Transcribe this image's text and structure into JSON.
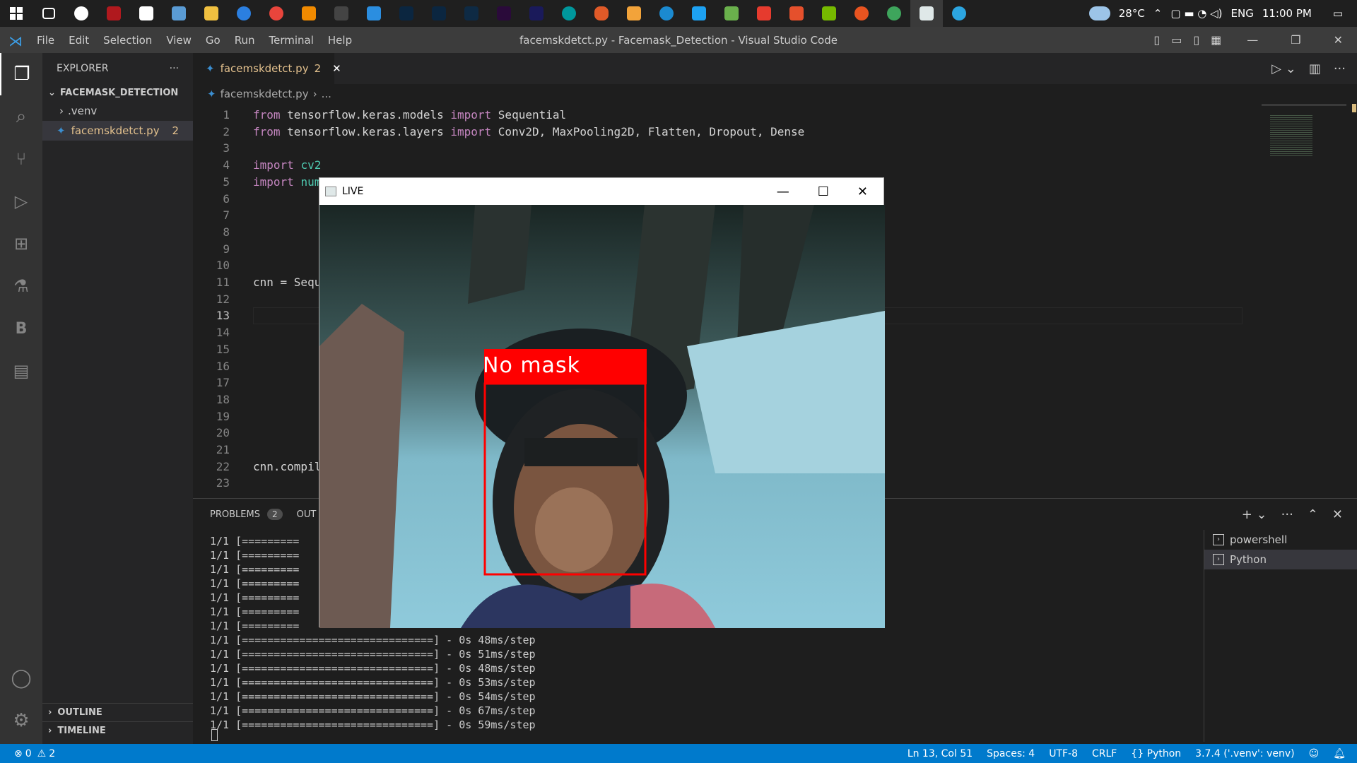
{
  "taskbar": {
    "temperature": "28°C",
    "language": "ENG",
    "time": "11:00 PM"
  },
  "vscode": {
    "menu": [
      "File",
      "Edit",
      "Selection",
      "View",
      "Go",
      "Run",
      "Terminal",
      "Help"
    ],
    "window_title": "facemskdetct.py - Facemask_Detection - Visual Studio Code",
    "explorer_title": "EXPLORER",
    "project": "FACEMASK_DETECTION",
    "tree": [
      {
        "label": ".venv",
        "badge": ""
      },
      {
        "label": "facemskdetct.py",
        "badge": "2"
      }
    ],
    "outline": "OUTLINE",
    "timeline": "TIMELINE",
    "tab": {
      "label": "facemskdetct.py",
      "badge": "2"
    },
    "breadcrumb": [
      "facemskdetct.py",
      "..."
    ],
    "code_lines": [
      {
        "n": "1",
        "tokens": [
          [
            "kw",
            "from "
          ],
          [
            "",
            "tensorflow.keras.models "
          ],
          [
            "kw",
            "import "
          ],
          [
            "",
            "Sequential"
          ]
        ]
      },
      {
        "n": "2",
        "tokens": [
          [
            "kw",
            "from "
          ],
          [
            "",
            "tensorflow.keras.layers "
          ],
          [
            "kw",
            "import "
          ],
          [
            "",
            "Conv2D, MaxPooling2D, Flatten, Dropout, Dense"
          ]
        ]
      },
      {
        "n": "3",
        "tokens": []
      },
      {
        "n": "4",
        "tokens": [
          [
            "kw",
            "import "
          ],
          [
            "mod",
            "cv2"
          ]
        ]
      },
      {
        "n": "5",
        "tokens": [
          [
            "kw",
            "import "
          ],
          [
            "mod",
            "num"
          ]
        ]
      },
      {
        "n": "6",
        "tokens": []
      },
      {
        "n": "7",
        "tokens": []
      },
      {
        "n": "8",
        "tokens": []
      },
      {
        "n": "9",
        "tokens": []
      },
      {
        "n": "10",
        "tokens": []
      },
      {
        "n": "11",
        "tokens": [
          [
            "",
            "cnn = Sequ"
          ]
        ]
      },
      {
        "n": "12",
        "tokens": []
      },
      {
        "n": "13",
        "tokens": []
      },
      {
        "n": "14",
        "tokens": []
      },
      {
        "n": "15",
        "tokens": []
      },
      {
        "n": "16",
        "tokens": []
      },
      {
        "n": "17",
        "tokens": []
      },
      {
        "n": "18",
        "tokens": []
      },
      {
        "n": "19",
        "tokens": []
      },
      {
        "n": "20",
        "tokens": []
      },
      {
        "n": "21",
        "tokens": []
      },
      {
        "n": "22",
        "tokens": [
          [
            "",
            "cnn.compil"
          ]
        ]
      },
      {
        "n": "23",
        "tokens": []
      }
    ],
    "panel": {
      "problems_label": "PROBLEMS",
      "problems_count": "2",
      "output_label": "OUT",
      "terminals": [
        "powershell",
        "Python"
      ],
      "lines": [
        "1/1 [=========",
        "1/1 [=========",
        "1/1 [=========",
        "1/1 [=========",
        "1/1 [=========",
        "1/1 [=========",
        "1/1 [=========",
        "1/1 [==============================] - 0s 48ms/step",
        "1/1 [==============================] - 0s 51ms/step",
        "1/1 [==============================] - 0s 48ms/step",
        "1/1 [==============================] - 0s 53ms/step",
        "1/1 [==============================] - 0s 54ms/step",
        "1/1 [==============================] - 0s 67ms/step",
        "1/1 [==============================] - 0s 59ms/step"
      ]
    },
    "status": {
      "errors": "0",
      "warnings": "2",
      "position": "Ln 13, Col 51",
      "spaces": "Spaces: 4",
      "encoding": "UTF-8",
      "eol": "CRLF",
      "language": "Python",
      "interpreter": "3.7.4 ('.venv': venv)"
    }
  },
  "live_window": {
    "title": "LIVE",
    "detection_label": "No mask",
    "box_color": "#ff0000"
  }
}
